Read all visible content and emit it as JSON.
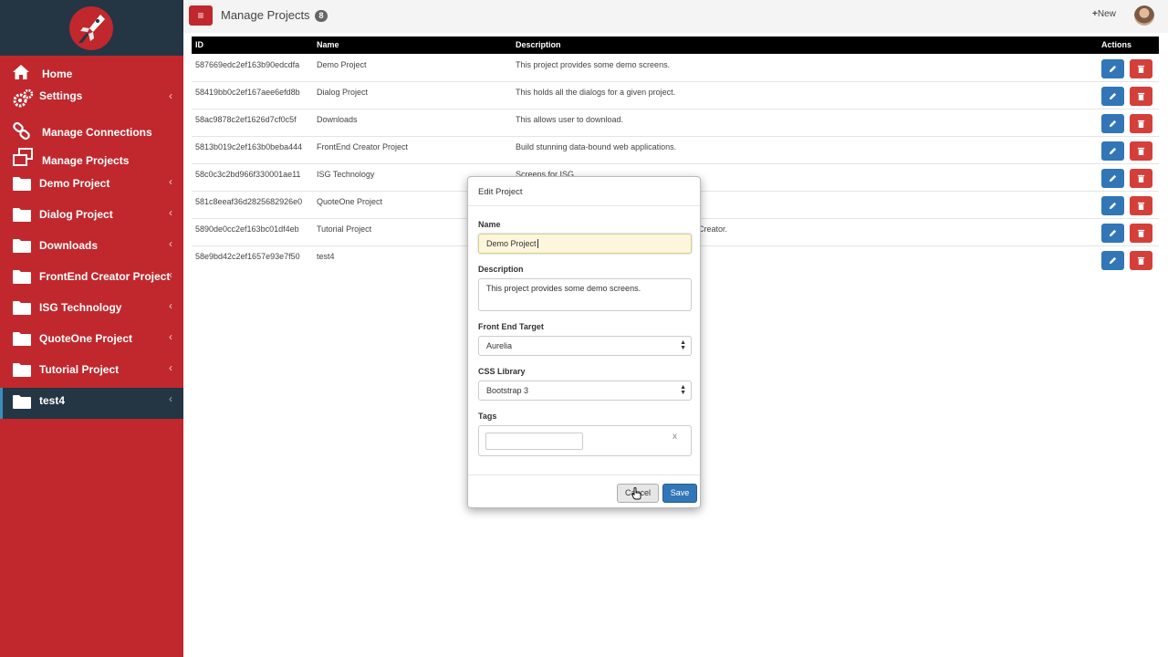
{
  "sidebar": {
    "items": [
      {
        "label": "Home",
        "icon": "home-icon",
        "has_chevron": false
      },
      {
        "label": "Settings",
        "icon": "gears-icon",
        "has_chevron": true
      },
      {
        "label": "Manage Connections",
        "icon": "link-icon",
        "has_chevron": false
      },
      {
        "label": "Manage Projects",
        "icon": "window-restore-icon",
        "has_chevron": false
      },
      {
        "label": "Demo Project",
        "icon": "folder-icon",
        "has_chevron": true
      },
      {
        "label": "Dialog Project",
        "icon": "folder-icon",
        "has_chevron": true
      },
      {
        "label": "Downloads",
        "icon": "folder-icon",
        "has_chevron": true
      },
      {
        "label": "FrontEnd Creator Project",
        "icon": "folder-icon",
        "has_chevron": true
      },
      {
        "label": "ISG Technology",
        "icon": "folder-icon",
        "has_chevron": true
      },
      {
        "label": "QuoteOne Project",
        "icon": "folder-icon",
        "has_chevron": true
      },
      {
        "label": "Tutorial Project",
        "icon": "folder-icon",
        "has_chevron": true
      },
      {
        "label": "test4",
        "icon": "folder-icon",
        "has_chevron": true,
        "active": true
      }
    ],
    "chevron": "‹"
  },
  "header": {
    "title": "Manage Projects",
    "count": "8",
    "new_label": "New",
    "menu_icon": "≡"
  },
  "table": {
    "columns": [
      "ID",
      "Name",
      "Description",
      "Actions"
    ],
    "rows": [
      {
        "id": "587669edc2ef163b90edcdfa",
        "name": "Demo Project",
        "description": "This project provides some demo screens."
      },
      {
        "id": "58419bb0c2ef167aee6efd8b",
        "name": "Dialog Project",
        "description": "This holds all the dialogs for a given project."
      },
      {
        "id": "58ac9878c2ef1626d7cf0c5f",
        "name": "Downloads",
        "description": "This allows user to download."
      },
      {
        "id": "5813b019c2ef163b0beba444",
        "name": "FrontEnd Creator Project",
        "description": "Build stunning data-bound web applications."
      },
      {
        "id": "58c0c3c2bd966f330001ae11",
        "name": "ISG Technology",
        "description": "Screens for ISG."
      },
      {
        "id": "581c8eeaf36d2825682926e0",
        "name": "QuoteOne Project",
        "description": ""
      },
      {
        "id": "5890de0cc2ef163bc01df4eb",
        "name": "Tutorial Project",
        "description": "Creator."
      },
      {
        "id": "58e9bd42c2ef1657e93e7f50",
        "name": "test4",
        "description": ""
      }
    ]
  },
  "modal": {
    "title": "Edit Project",
    "name_label": "Name",
    "name_value": "Demo Project",
    "description_label": "Description",
    "description_value": "This project provides some demo screens.",
    "frontend_label": "Front End Target",
    "frontend_value": "Aurelia",
    "css_label": "CSS Library",
    "css_value": "Bootstrap 3",
    "tags_label": "Tags",
    "tags_clear": "x",
    "cancel_label": "Cancel",
    "save_label": "Save"
  },
  "colors": {
    "sidebar_bg": "#c0282d",
    "sidebar_dark": "#243544",
    "edit_button": "#3276b8",
    "delete_button": "#d43f3a"
  }
}
